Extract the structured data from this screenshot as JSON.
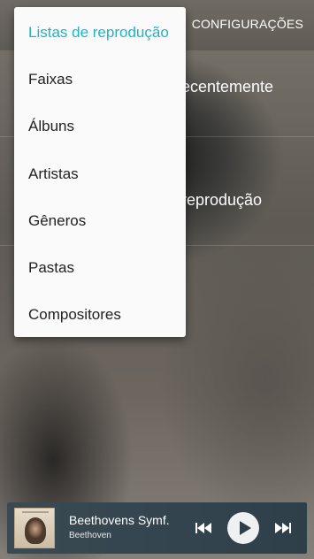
{
  "header": {
    "settings_tab": "CONFIGURAÇÕES"
  },
  "background_list": {
    "item1": "ecentemente",
    "item2": "reprodução"
  },
  "dropdown": {
    "items": [
      {
        "label": "Listas de reprodução",
        "selected": true
      },
      {
        "label": "Faixas"
      },
      {
        "label": "Álbuns"
      },
      {
        "label": "Artistas"
      },
      {
        "label": "Gêneros"
      },
      {
        "label": "Pastas"
      },
      {
        "label": "Compositores"
      }
    ]
  },
  "player": {
    "track_title": "Beethovens Symf.",
    "artist": "Beethoven",
    "icons": [
      "album-art",
      "previous-icon",
      "play-icon",
      "next-icon"
    ]
  },
  "colors": {
    "accent": "#1cb5c9",
    "menu_bg": "#fafafa",
    "player_bg": "#33444f"
  }
}
